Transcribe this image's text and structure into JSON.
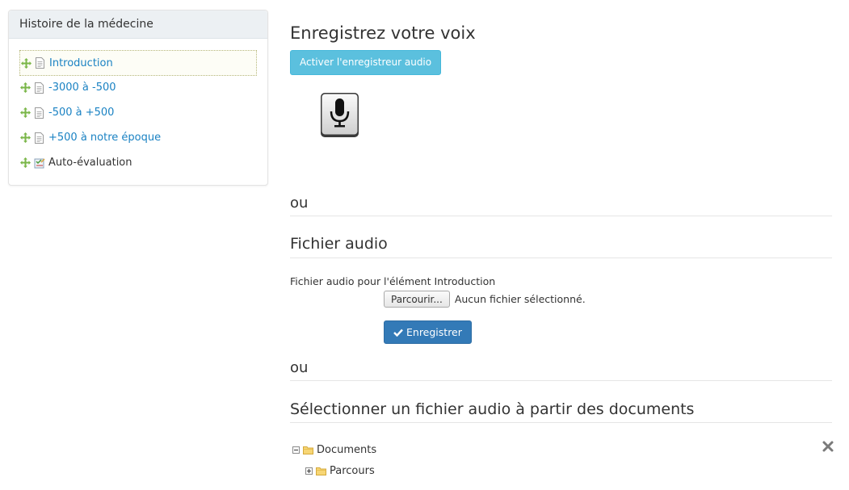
{
  "sidebar": {
    "title": "Histoire de la médecine",
    "items": [
      {
        "label": "Introduction",
        "icon": "document-icon",
        "active": true
      },
      {
        "label": "-3000 à -500",
        "icon": "document-icon"
      },
      {
        "label": "-500 à +500",
        "icon": "document-icon"
      },
      {
        "label": "+500 à notre époque",
        "icon": "document-icon"
      },
      {
        "label": "Auto-évaluation",
        "icon": "quiz-icon"
      }
    ]
  },
  "main": {
    "record_title": "Enregistrez votre voix",
    "activate_button": "Activer l'enregistreur audio",
    "or_1": "ou",
    "audio_title": "Fichier audio",
    "file_label": "Fichier audio pour l'élément Introduction",
    "browse_button": "Parcourir...",
    "file_status": "Aucun fichier sélectionné.",
    "save_button": "Enregistrer",
    "or_2": "ou",
    "docs_title": "Sélectionner un fichier audio à partir des documents",
    "tree": [
      {
        "label": "Documents",
        "toggle": "minus"
      },
      {
        "label": "Parcours",
        "toggle": "plus"
      }
    ]
  },
  "colors": {
    "link": "#1a82c3",
    "info_button": "#5bc0de",
    "primary_button": "#337ab7",
    "move_icon": "#7ab648"
  }
}
